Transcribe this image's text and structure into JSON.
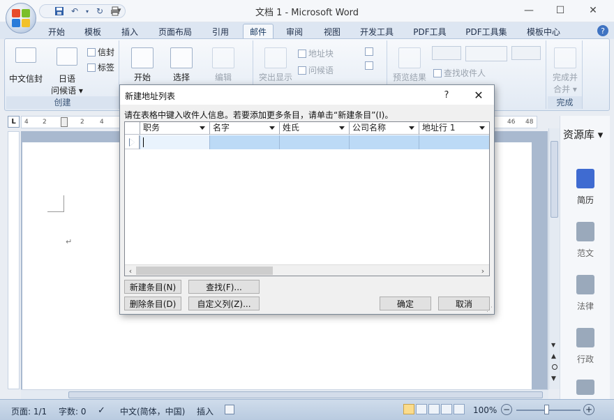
{
  "window": {
    "title": "文档 1 - Microsoft Word",
    "controls": {
      "minimize": "—",
      "maximize": "☐",
      "close": "✕"
    }
  },
  "quick_access": {
    "customize": "▾"
  },
  "ribbon": {
    "tabs": [
      {
        "label": "开始"
      },
      {
        "label": "模板"
      },
      {
        "label": "插入"
      },
      {
        "label": "页面布局"
      },
      {
        "label": "引用"
      },
      {
        "label": "邮件",
        "active": true
      },
      {
        "label": "审阅"
      },
      {
        "label": "视图"
      },
      {
        "label": "开发工具"
      },
      {
        "label": "PDF工具"
      },
      {
        "label": "PDF工具集"
      },
      {
        "label": "模板中心"
      }
    ],
    "help": "?",
    "groups": {
      "create": {
        "label": "创建",
        "envelope": "中文信封",
        "japanese_postcard": {
          "line1": "日语",
          "line2": "问候语 ▾"
        },
        "envelopes": "信封",
        "labels": "标签"
      },
      "start_merge": {
        "start": "开始",
        "select": "选择",
        "edit": "编辑"
      },
      "write_insert": {
        "highlight": "突出显示",
        "address_block": "地址块",
        "greeting_line": "问候语"
      },
      "preview": {
        "preview_results": "预览结果",
        "find_recipient": "查找收件人"
      },
      "finish": {
        "label": "完成",
        "finish_merge_line1": "完成并",
        "finish_merge_line2": "合并 ▾"
      }
    }
  },
  "ruler": {
    "corner": "L",
    "left_numbers": [
      "4",
      "2",
      "2",
      "4"
    ],
    "right_numbers": [
      "46",
      "48"
    ]
  },
  "side_panel": {
    "title": "资源库 ▾",
    "items": [
      {
        "label": "简历",
        "active": true
      },
      {
        "label": "范文"
      },
      {
        "label": "法律"
      },
      {
        "label": "行政"
      }
    ]
  },
  "dialog": {
    "title": "新建地址列表",
    "help": "?",
    "close": "✕",
    "instruction": "请在表格中键入收件人信息。若要添加更多条目，请单击“新建条目”(I)。",
    "columns": [
      "职务",
      "名字",
      "姓氏",
      "公司名称",
      "地址行 1"
    ],
    "buttons": {
      "new_entry": "新建条目(N)",
      "find": "查找(F)...",
      "delete_entry": "删除条目(D)",
      "customize_columns": "自定义列(Z)...",
      "ok": "确定",
      "cancel": "取消"
    }
  },
  "status_bar": {
    "page": "页面: 1/1",
    "words": "字数: 0",
    "language": "中文(简体，中国)",
    "mode": "插入",
    "zoom": "100%",
    "zoom_minus": "−",
    "zoom_plus": "+"
  },
  "colors": {
    "accent_blue": "#3f6bd1",
    "selection_blue": "#bcdaf6",
    "ribbon_bg": "#e2eaf4"
  }
}
